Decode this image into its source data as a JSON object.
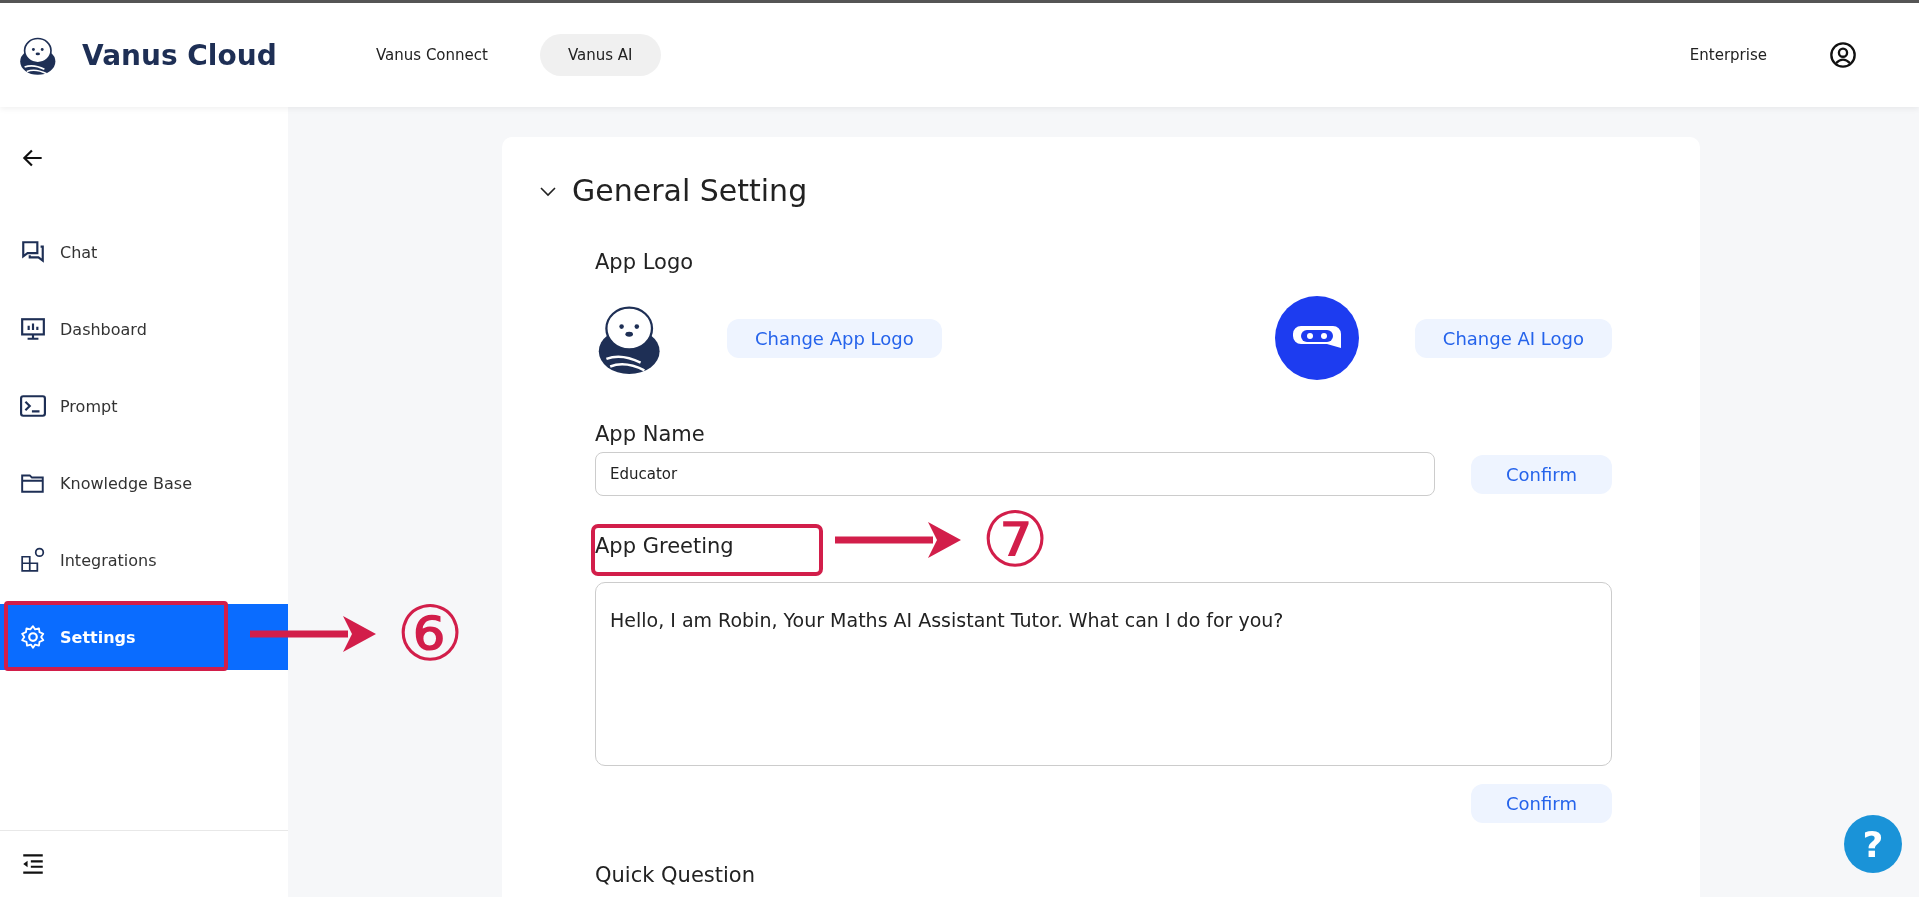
{
  "header": {
    "brand": "Vanus Cloud",
    "nav": [
      {
        "label": "Vanus Connect",
        "selected": false
      },
      {
        "label": "Vanus AI",
        "selected": true
      }
    ],
    "plan": "Enterprise"
  },
  "sidebar": {
    "items": [
      {
        "label": "Chat",
        "kind": "chat",
        "selected": false,
        "highlighted": false
      },
      {
        "label": "Dashboard",
        "kind": "dashboard",
        "selected": false,
        "highlighted": false
      },
      {
        "label": "Prompt",
        "kind": "prompt",
        "selected": false,
        "highlighted": false
      },
      {
        "label": "Knowledge Base",
        "kind": "folder",
        "selected": false,
        "highlighted": false
      },
      {
        "label": "Integrations",
        "kind": "integrations",
        "selected": false,
        "highlighted": false
      },
      {
        "label": "Settings",
        "kind": "settings",
        "selected": true,
        "highlighted": true
      }
    ]
  },
  "settings": {
    "title": "General Setting",
    "expanded": true,
    "logo_label": "App Logo",
    "change_app_logo": "Change App Logo",
    "change_ai_logo": "Change AI Logo",
    "name_label": "App Name",
    "name_value": "Educator",
    "name_confirm": "Confirm",
    "greeting_label": "App Greeting",
    "greeting_highlighted": true,
    "greeting_value": "Hello, I am Robin, Your Maths AI Assistant Tutor. What can I do for you?",
    "greeting_confirm": "Confirm",
    "quick_label": "Quick Question"
  },
  "annotations": [
    {
      "label": "⑥"
    },
    {
      "label": "⑦"
    }
  ],
  "help": "?"
}
